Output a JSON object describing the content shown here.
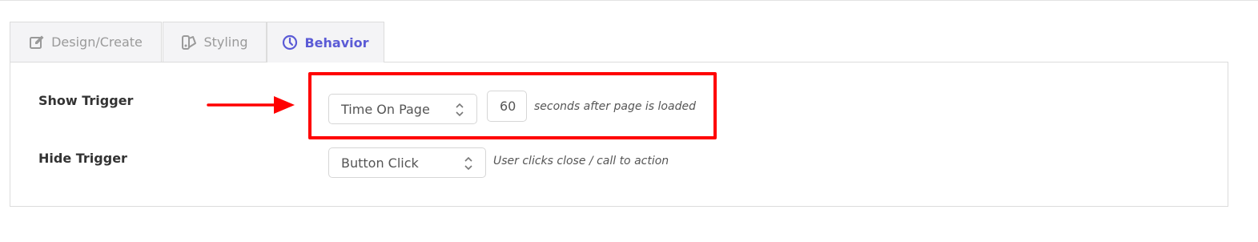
{
  "tabs": [
    {
      "label": "Design/Create",
      "icon": "edit-icon"
    },
    {
      "label": "Styling",
      "icon": "palette-icon"
    },
    {
      "label": "Behavior",
      "icon": "clock-icon"
    }
  ],
  "active_tab": "Behavior",
  "colors": {
    "accent": "#5b5bd6",
    "highlight": "#ff0000"
  },
  "show_trigger": {
    "label": "Show Trigger",
    "selected": "Time On Page",
    "seconds_value": "60",
    "hint": "seconds after page is loaded"
  },
  "hide_trigger": {
    "label": "Hide Trigger",
    "selected": "Button Click",
    "hint": "User clicks close / call to action"
  }
}
